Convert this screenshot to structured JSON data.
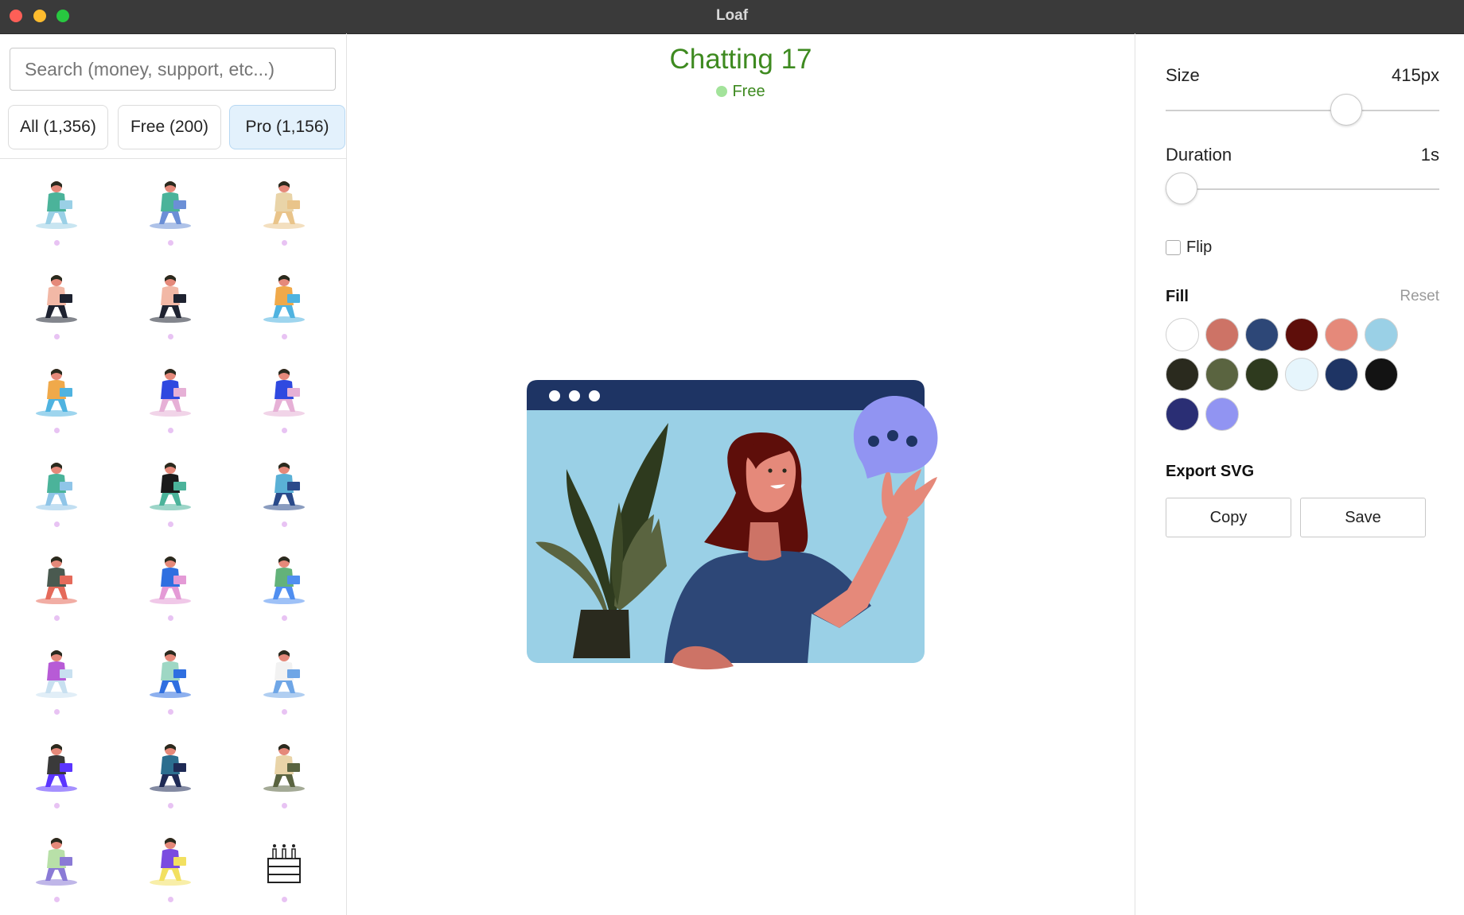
{
  "window": {
    "title": "Loaf"
  },
  "sidebar": {
    "search_placeholder": "Search (money, support, etc...)",
    "filters": [
      {
        "label": "All (1,356)",
        "active": false
      },
      {
        "label": "Free (200)",
        "active": false
      },
      {
        "label": "Pro (1,156)",
        "active": true
      }
    ],
    "items": [
      {
        "icon": "person-sitting-laptop-icon"
      },
      {
        "icon": "person-standing-phone-icon"
      },
      {
        "icon": "person-sofa-laptop-icon"
      },
      {
        "icon": "person-laptop-cross-legged-icon"
      },
      {
        "icon": "person-laptop-cross-legged-icon"
      },
      {
        "icon": "person-laptop-sitting-icon"
      },
      {
        "icon": "person-laptop-sitting-icon"
      },
      {
        "icon": "person-walking-phone-icon"
      },
      {
        "icon": "person-walking-phone-icon"
      },
      {
        "icon": "person-tablet-icon"
      },
      {
        "icon": "person-standing-phone-icon"
      },
      {
        "icon": "person-walking-phone-icon"
      },
      {
        "icon": "person-lounge-chair-icon"
      },
      {
        "icon": "person-lying-laptop-icon"
      },
      {
        "icon": "person-laptop-sitting-icon"
      },
      {
        "icon": "person-desk-chair-icon"
      },
      {
        "icon": "person-laptop-sitting-icon"
      },
      {
        "icon": "person-walking-laptop-icon"
      },
      {
        "icon": "person-desk-computer-icon"
      },
      {
        "icon": "person-meditating-icon"
      },
      {
        "icon": "person-lying-phone-icon"
      },
      {
        "icon": "person-lying-icon"
      },
      {
        "icon": "person-sitting-phone-icon"
      },
      {
        "icon": "birthday-cake-icon"
      }
    ]
  },
  "main": {
    "title": "Chatting 17",
    "badge": "Free",
    "preview_icon": "chatting-illustration-icon"
  },
  "panel": {
    "size": {
      "label": "Size",
      "value": "415px",
      "fraction": 0.68
    },
    "duration": {
      "label": "Duration",
      "value": "1s",
      "fraction": 0.0
    },
    "flip": {
      "label": "Flip",
      "checked": false
    },
    "fill": {
      "title": "Fill",
      "reset_label": "Reset",
      "colors": [
        "#ffffff",
        "#cd7366",
        "#2d4777",
        "#5e0e0a",
        "#e5897a",
        "#9ad0e6",
        "#2a2a1e",
        "#5a6440",
        "#2e3a1e",
        "#e6f5fc",
        "#1e3464",
        "#131313",
        "#2a2e74",
        "#9194f2"
      ]
    },
    "export": {
      "title": "Export SVG",
      "copy_label": "Copy",
      "save_label": "Save"
    }
  }
}
